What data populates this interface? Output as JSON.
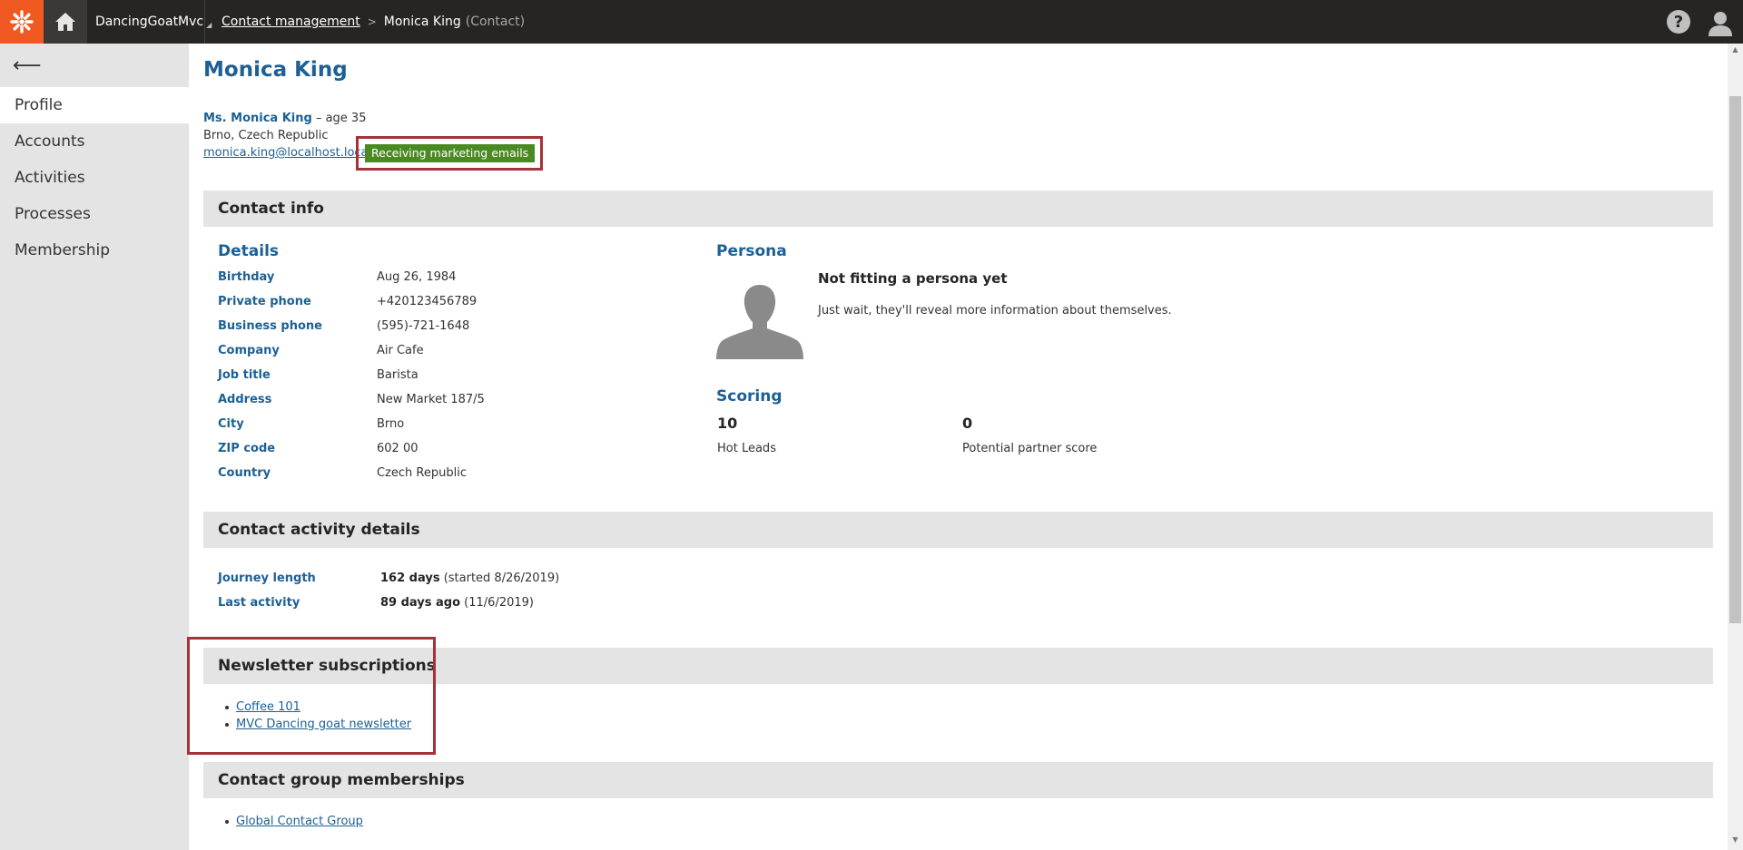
{
  "header": {
    "site_name": "DancingGoatMvc",
    "breadcrumb_link": "Contact management",
    "breadcrumb_current": "Monica King",
    "breadcrumb_type": "(Contact)",
    "help_glyph": "?"
  },
  "sidebar": {
    "back_glyph": "⟵",
    "items": [
      {
        "label": "Profile",
        "active": true
      },
      {
        "label": "Accounts"
      },
      {
        "label": "Activities"
      },
      {
        "label": "Processes"
      },
      {
        "label": "Membership"
      }
    ]
  },
  "profile": {
    "title": "Monica King",
    "full_name": "Ms. Monica King",
    "age_text": " – age 35",
    "location": "Brno, Czech Republic",
    "email": "monica.king@localhost.loca",
    "marketing_badge": "Receiving marketing emails"
  },
  "contact_info": {
    "header": "Contact info",
    "details_title": "Details",
    "details": [
      {
        "label": "Birthday",
        "value": "Aug 26, 1984"
      },
      {
        "label": "Private phone",
        "value": "+420123456789"
      },
      {
        "label": "Business phone",
        "value": "(595)-721-1648"
      },
      {
        "label": "Company",
        "value": "Air Cafe"
      },
      {
        "label": "Job title",
        "value": "Barista"
      },
      {
        "label": "Address",
        "value": "New Market 187/5"
      },
      {
        "label": "City",
        "value": "Brno"
      },
      {
        "label": "ZIP code",
        "value": "602 00"
      },
      {
        "label": "Country",
        "value": "Czech Republic"
      }
    ],
    "persona_title": "Persona",
    "persona_name": "Not fitting a persona yet",
    "persona_desc": "Just wait, they'll reveal more information about themselves.",
    "scoring_title": "Scoring",
    "scores": [
      {
        "value": "10",
        "label": "Hot Leads"
      },
      {
        "value": "0",
        "label": "Potential partner score"
      }
    ]
  },
  "activity": {
    "header": "Contact activity details",
    "journey_label": "Journey length",
    "journey_value": "162 days",
    "journey_note": " (started 8/26/2019)",
    "last_label": "Last activity",
    "last_value": "89 days ago",
    "last_note": " (11/6/2019)"
  },
  "newsletters": {
    "header": "Newsletter subscriptions",
    "items": [
      "Coffee 101",
      "MVC Dancing goat newsletter"
    ]
  },
  "groups": {
    "header": "Contact group memberships",
    "items": [
      "Global Contact Group"
    ]
  },
  "colors": {
    "accent": "#1c6095",
    "logo": "#f05a22",
    "badge": "#4b8a22",
    "highlight": "#a5323a"
  }
}
